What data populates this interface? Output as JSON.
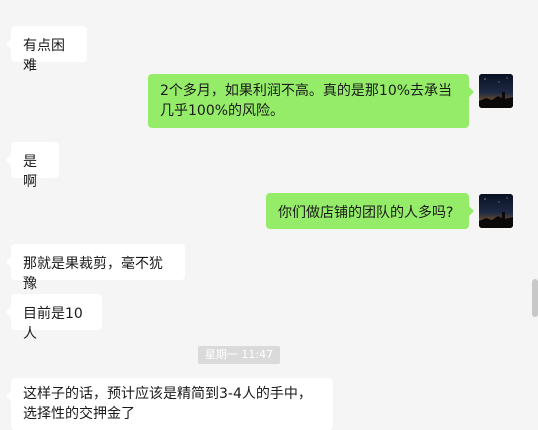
{
  "messages": [
    {
      "side": "in",
      "text": "有点困难"
    },
    {
      "side": "out",
      "text": "2个多月，如果利润不高。真的是那10%去承当几乎100%的风险。"
    },
    {
      "side": "in",
      "text": "是啊"
    },
    {
      "side": "out",
      "text": "你们做店铺的团队的人多吗?"
    },
    {
      "side": "in",
      "text": "那就是果裁剪，毫不犹豫"
    },
    {
      "side": "in",
      "text": "目前是10人"
    },
    {
      "side": "in",
      "text": "这样子的话，预计应该是精简到3-4人的手中，选择性的交押金了"
    }
  ],
  "timestamp": "星期一 11:47",
  "colors": {
    "chat_background": "#f5f5f5",
    "incoming_bubble": "#ffffff",
    "outgoing_bubble": "#95ec69",
    "timestamp_badge": "#dadada"
  },
  "icons": {
    "user_avatar": "night-sky-avatar-icon"
  }
}
